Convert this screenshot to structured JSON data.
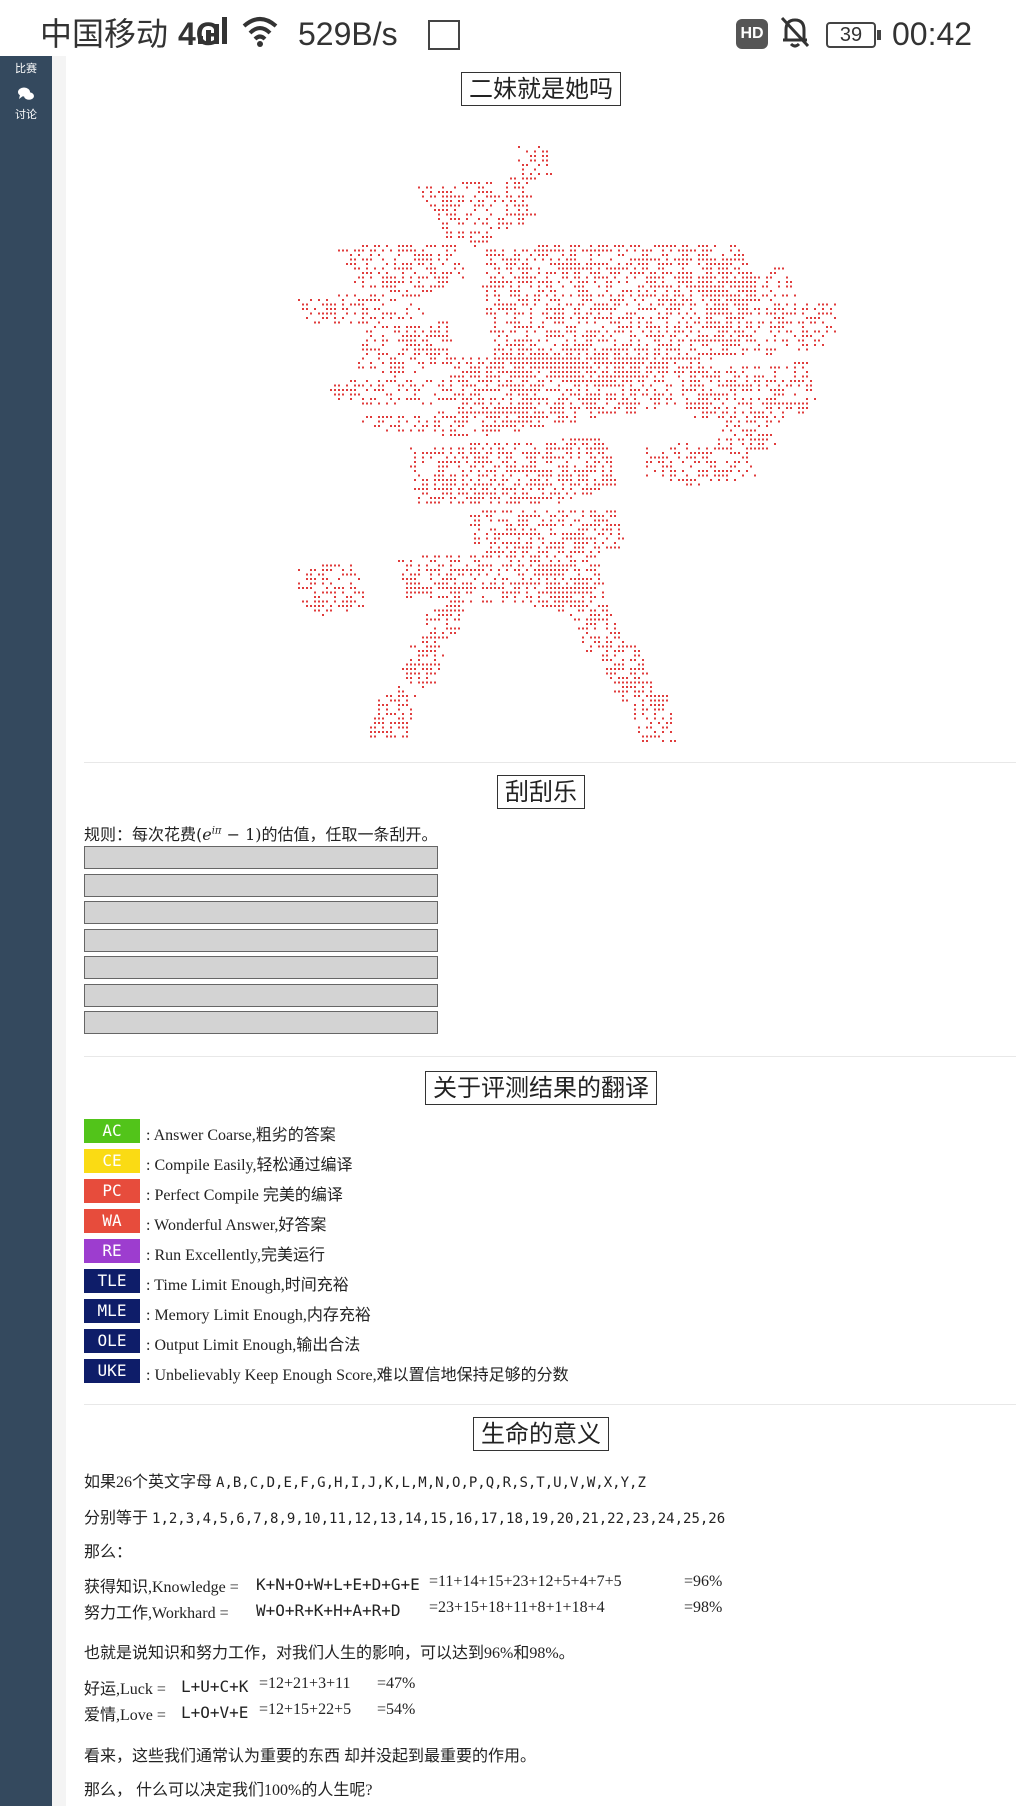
{
  "status_bar": {
    "carrier": "中国移动",
    "network": "4G",
    "speed": "529B/s",
    "hd": "HD",
    "battery": "39",
    "time": "00:42"
  },
  "sidebar": {
    "items": [
      {
        "label": "比赛",
        "icon": "trophy-icon"
      },
      {
        "label": "讨论",
        "icon": "chat-bubbles-icon"
      }
    ]
  },
  "section_art": {
    "title": "二妹就是她吗",
    "art_color": "#e03c3c"
  },
  "section_scratch": {
    "title": "刮刮乐",
    "rule_prefix": "规则：每次花费(",
    "rule_math": "e",
    "rule_exponent": "iπ",
    "rule_math_tail": " − 1)",
    "rule_suffix": "的估值，任取一条刮开。",
    "cards": 7
  },
  "section_verdicts": {
    "title": "关于评测结果的翻译",
    "items": [
      {
        "code": "AC",
        "color": "#52c41a",
        "text": ": Answer Coarse,粗劣的答案"
      },
      {
        "code": "CE",
        "color": "#fadb14",
        "text": ": Compile Easily,轻松通过编译"
      },
      {
        "code": "PC",
        "color": "#e74c3c",
        "text": ": Perfect Compile 完美的编译"
      },
      {
        "code": "WA",
        "color": "#e74c3c",
        "text": ": Wonderful Answer,好答案"
      },
      {
        "code": "RE",
        "color": "#9d3dcf",
        "text": ": Run Excellently,完美运行"
      },
      {
        "code": "TLE",
        "color": "#0e1d69",
        "text": ": Time Limit Enough,时间充裕"
      },
      {
        "code": "MLE",
        "color": "#0e1d69",
        "text": ": Memory Limit Enough,内存充裕"
      },
      {
        "code": "OLE",
        "color": "#0e1d69",
        "text": ": Output Limit Enough,输出合法"
      },
      {
        "code": "UKE",
        "color": "#0e1d69",
        "text": ": Unbelievably Keep Enough Score,难以置信地保持足够的分数"
      }
    ]
  },
  "section_life": {
    "title": "生命的意义",
    "line1_prefix": "如果26个英文字母 ",
    "letters": "A,B,C,D,E,F,G,H,I,J,K,L,M,N,O,P,Q,R,S,T,U,V,W,X,Y,Z",
    "line2_prefix": "分别等于 ",
    "numbers": "1,2,3,4,5,6,7,8,9,10,11,12,13,14,15,16,17,18,19,20,21,22,23,24,25,26",
    "then": "那么：",
    "rows1": [
      {
        "label": "获得知识,Knowledge =",
        "letters": "K+N+O+W+L+E+D+G+E",
        "sum": "=11+14+15+23+12+5+4+7+5",
        "result": "=96%"
      },
      {
        "label": " 努力工作,Workhard =",
        "letters": "W+O+R+K+H+A+R+D",
        "sum": "=23+15+18+11+8+1+18+4",
        "result": "=98%"
      }
    ],
    "conclusion1": "也就是说知识和努力工作，对我们人生的影响，可以达到96%和98%。",
    "rows2": [
      {
        "label": "好运,Luck =",
        "letters": "L+U+C+K",
        "sum": "=12+21+3+11",
        "result": "=47%"
      },
      {
        "label": "爱情,Love =",
        "letters": "L+O+V+E",
        "sum": "=12+15+22+5",
        "result": "=54%"
      }
    ],
    "conclusion2": "看来，这些我们通常认为重要的东西 却并没起到最重要的作用。",
    "question": "那么， 什么可以决定我们100%的人生呢?"
  }
}
